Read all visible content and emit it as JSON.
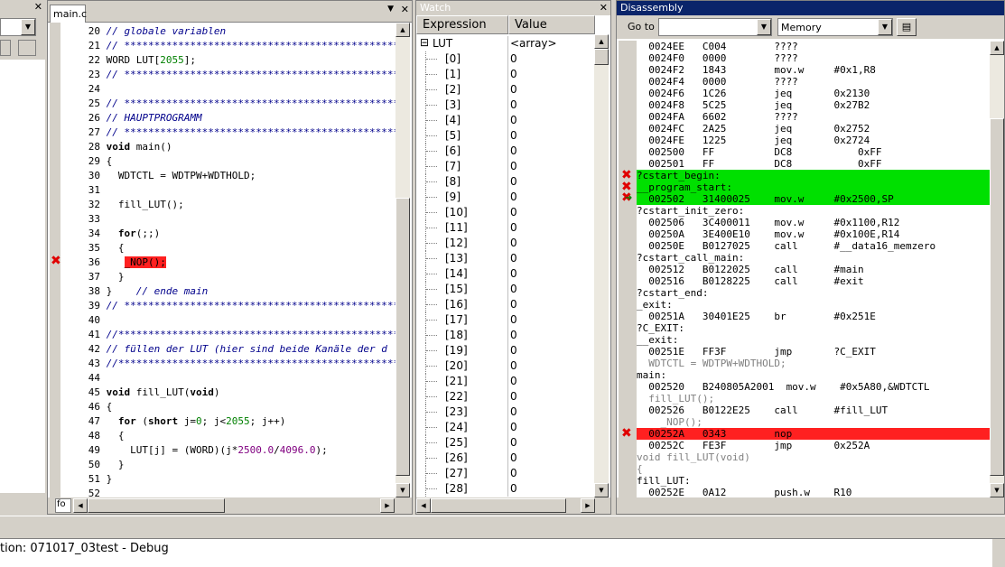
{
  "editor": {
    "tab_label": "main.c",
    "lines": [
      {
        "n": "20",
        "parts": [
          {
            "t": "// globale variablen",
            "c": "cm"
          }
        ]
      },
      {
        "n": "21",
        "parts": [
          {
            "t": "// ***************************************************",
            "c": "cm"
          }
        ]
      },
      {
        "n": "22",
        "parts": [
          {
            "t": "WORD LUT[",
            "c": ""
          },
          {
            "t": "2055",
            "c": "num"
          },
          {
            "t": "];",
            "c": ""
          }
        ]
      },
      {
        "n": "23",
        "parts": [
          {
            "t": "// ***************************************************",
            "c": "cm"
          }
        ]
      },
      {
        "n": "24",
        "parts": []
      },
      {
        "n": "25",
        "parts": [
          {
            "t": "// ***************************************************",
            "c": "cm"
          }
        ]
      },
      {
        "n": "26",
        "parts": [
          {
            "t": "// HAUPTPROGRAMM",
            "c": "cm"
          }
        ]
      },
      {
        "n": "27",
        "parts": [
          {
            "t": "// ***************************************************",
            "c": "cm"
          }
        ]
      },
      {
        "n": "28",
        "parts": [
          {
            "t": "void",
            "c": "kw"
          },
          {
            "t": " main()",
            "c": ""
          }
        ]
      },
      {
        "n": "29",
        "parts": [
          {
            "t": "{",
            "c": ""
          }
        ]
      },
      {
        "n": "30",
        "parts": [
          {
            "t": "  WDTCTL = WDTPW+WDTHOLD;",
            "c": ""
          }
        ]
      },
      {
        "n": "31",
        "parts": []
      },
      {
        "n": "32",
        "parts": [
          {
            "t": "  fill_LUT();",
            "c": ""
          }
        ]
      },
      {
        "n": "33",
        "parts": []
      },
      {
        "n": "34",
        "parts": [
          {
            "t": "  ",
            "c": ""
          },
          {
            "t": "for",
            "c": "kw"
          },
          {
            "t": "(;;)",
            "c": ""
          }
        ]
      },
      {
        "n": "35",
        "parts": [
          {
            "t": "  {",
            "c": ""
          }
        ]
      },
      {
        "n": "36",
        "parts": [
          {
            "t": "   ",
            "c": ""
          },
          {
            "t": "_NOP();",
            "c": "hl"
          }
        ]
      },
      {
        "n": "37",
        "parts": [
          {
            "t": "  }",
            "c": ""
          }
        ]
      },
      {
        "n": "38",
        "parts": [
          {
            "t": "}  ",
            "c": ""
          },
          {
            "t": "  // ende main",
            "c": "cm"
          }
        ]
      },
      {
        "n": "39",
        "parts": [
          {
            "t": "// ***************************************************",
            "c": "cm"
          }
        ]
      },
      {
        "n": "40",
        "parts": []
      },
      {
        "n": "41",
        "parts": [
          {
            "t": "//****************************************************",
            "c": "cm"
          }
        ]
      },
      {
        "n": "42",
        "parts": [
          {
            "t": "// füllen der LUT (hier sind beide Kanäle der d",
            "c": "cm"
          }
        ]
      },
      {
        "n": "43",
        "parts": [
          {
            "t": "//****************************************************",
            "c": "cm"
          }
        ]
      },
      {
        "n": "44",
        "parts": []
      },
      {
        "n": "45",
        "parts": [
          {
            "t": "void",
            "c": "kw"
          },
          {
            "t": " fill_LUT(",
            "c": ""
          },
          {
            "t": "void",
            "c": "kw"
          },
          {
            "t": ")",
            "c": ""
          }
        ]
      },
      {
        "n": "46",
        "parts": [
          {
            "t": "{",
            "c": ""
          }
        ]
      },
      {
        "n": "47",
        "parts": [
          {
            "t": "  ",
            "c": ""
          },
          {
            "t": "for",
            "c": "kw"
          },
          {
            "t": " (",
            "c": ""
          },
          {
            "t": "short",
            "c": "kw"
          },
          {
            "t": " j=",
            "c": ""
          },
          {
            "t": "0",
            "c": "num"
          },
          {
            "t": "; j<",
            "c": ""
          },
          {
            "t": "2055",
            "c": "num"
          },
          {
            "t": "; j++)",
            "c": ""
          }
        ]
      },
      {
        "n": "48",
        "parts": [
          {
            "t": "  {",
            "c": ""
          }
        ]
      },
      {
        "n": "49",
        "parts": [
          {
            "t": "    LUT[j] = (WORD)(j*",
            "c": ""
          },
          {
            "t": "2500.0",
            "c": "fnum"
          },
          {
            "t": "/",
            "c": ""
          },
          {
            "t": "4096.0",
            "c": "fnum"
          },
          {
            "t": ");",
            "c": ""
          }
        ]
      },
      {
        "n": "50",
        "parts": [
          {
            "t": "  }",
            "c": ""
          }
        ]
      },
      {
        "n": "51",
        "parts": [
          {
            "t": "}",
            "c": ""
          }
        ]
      },
      {
        "n": "52",
        "parts": []
      }
    ],
    "bottom_tab": "fo"
  },
  "watch": {
    "title": "Watch",
    "col_expression": "Expression",
    "col_value": "Value",
    "root_name": "LUT",
    "root_value": "<array>",
    "root_toggle": "⊟",
    "items": [
      {
        "e": "[0]",
        "v": "0"
      },
      {
        "e": "[1]",
        "v": "0"
      },
      {
        "e": "[2]",
        "v": "0"
      },
      {
        "e": "[3]",
        "v": "0"
      },
      {
        "e": "[4]",
        "v": "0"
      },
      {
        "e": "[5]",
        "v": "0"
      },
      {
        "e": "[6]",
        "v": "0"
      },
      {
        "e": "[7]",
        "v": "0"
      },
      {
        "e": "[8]",
        "v": "0"
      },
      {
        "e": "[9]",
        "v": "0"
      },
      {
        "e": "[10]",
        "v": "0"
      },
      {
        "e": "[11]",
        "v": "0"
      },
      {
        "e": "[12]",
        "v": "0"
      },
      {
        "e": "[13]",
        "v": "0"
      },
      {
        "e": "[14]",
        "v": "0"
      },
      {
        "e": "[15]",
        "v": "0"
      },
      {
        "e": "[16]",
        "v": "0"
      },
      {
        "e": "[17]",
        "v": "0"
      },
      {
        "e": "[18]",
        "v": "0"
      },
      {
        "e": "[19]",
        "v": "0"
      },
      {
        "e": "[20]",
        "v": "0"
      },
      {
        "e": "[21]",
        "v": "0"
      },
      {
        "e": "[22]",
        "v": "0"
      },
      {
        "e": "[23]",
        "v": "0"
      },
      {
        "e": "[24]",
        "v": "0"
      },
      {
        "e": "[25]",
        "v": "0"
      },
      {
        "e": "[26]",
        "v": "0"
      },
      {
        "e": "[27]",
        "v": "0"
      },
      {
        "e": "[28]",
        "v": "0"
      }
    ]
  },
  "disasm": {
    "title": "Disassembly",
    "goto_label": "Go to",
    "goto_value": "",
    "memory_value": "Memory",
    "lines": [
      {
        "t": "  0024EE   C004        ????",
        "s": ""
      },
      {
        "t": "  0024F0   0000        ????",
        "s": ""
      },
      {
        "t": "  0024F2   1843        mov.w     #0x1,R8",
        "s": ""
      },
      {
        "t": "  0024F4   0000        ????",
        "s": ""
      },
      {
        "t": "  0024F6   1C26        jeq       0x2130",
        "s": ""
      },
      {
        "t": "  0024F8   5C25        jeq       0x27B2",
        "s": ""
      },
      {
        "t": "  0024FA   6602        ????",
        "s": ""
      },
      {
        "t": "  0024FC   2A25        jeq       0x2752",
        "s": ""
      },
      {
        "t": "  0024FE   1225        jeq       0x2724",
        "s": ""
      },
      {
        "t": "  002500   FF          DC8           0xFF",
        "s": ""
      },
      {
        "t": "  002501   FF          DC8           0xFF",
        "s": ""
      },
      {
        "t": "?cstart_begin:",
        "s": "green"
      },
      {
        "t": "__program_start:",
        "s": "green"
      },
      {
        "t": "  002502   31400025    mov.w     #0x2500,SP",
        "s": "green"
      },
      {
        "t": "?cstart_init_zero:",
        "s": ""
      },
      {
        "t": "  002506   3C400011    mov.w     #0x1100,R12",
        "s": ""
      },
      {
        "t": "  00250A   3E400E10    mov.w     #0x100E,R14",
        "s": ""
      },
      {
        "t": "  00250E   B0127025    call      #__data16_memzero",
        "s": ""
      },
      {
        "t": "?cstart_call_main:",
        "s": ""
      },
      {
        "t": "  002512   B0122025    call      #main",
        "s": ""
      },
      {
        "t": "  002516   B0128225    call      #exit",
        "s": ""
      },
      {
        "t": "?cstart_end:",
        "s": ""
      },
      {
        "t": "_exit:",
        "s": ""
      },
      {
        "t": "  00251A   30401E25    br        #0x251E",
        "s": ""
      },
      {
        "t": "?C_EXIT:",
        "s": ""
      },
      {
        "t": "__exit:",
        "s": ""
      },
      {
        "t": "  00251E   FF3F        jmp       ?C_EXIT",
        "s": ""
      },
      {
        "t": "  WDTCTL = WDTPW+WDTHOLD;",
        "s": "gray"
      },
      {
        "t": "main:",
        "s": ""
      },
      {
        "t": "  002520   B240805A2001  mov.w    #0x5A80,&WDTCTL",
        "s": ""
      },
      {
        "t": "  fill_LUT();",
        "s": "gray"
      },
      {
        "t": "  002526   B0122E25    call      #fill_LUT",
        "s": ""
      },
      {
        "t": "    _NOP();",
        "s": "gray"
      },
      {
        "t": "  00252A   0343        nop",
        "s": "red"
      },
      {
        "t": "  00252C   FE3F        jmp       0x252A",
        "s": ""
      },
      {
        "t": "void fill_LUT(void)",
        "s": "gray"
      },
      {
        "t": "{",
        "s": "gray"
      },
      {
        "t": "fill_LUT:",
        "s": ""
      },
      {
        "t": "  00252E   0A12        push.w    R10",
        "s": ""
      }
    ]
  },
  "status": {
    "text": "tion: 071017_03test - Debug"
  }
}
